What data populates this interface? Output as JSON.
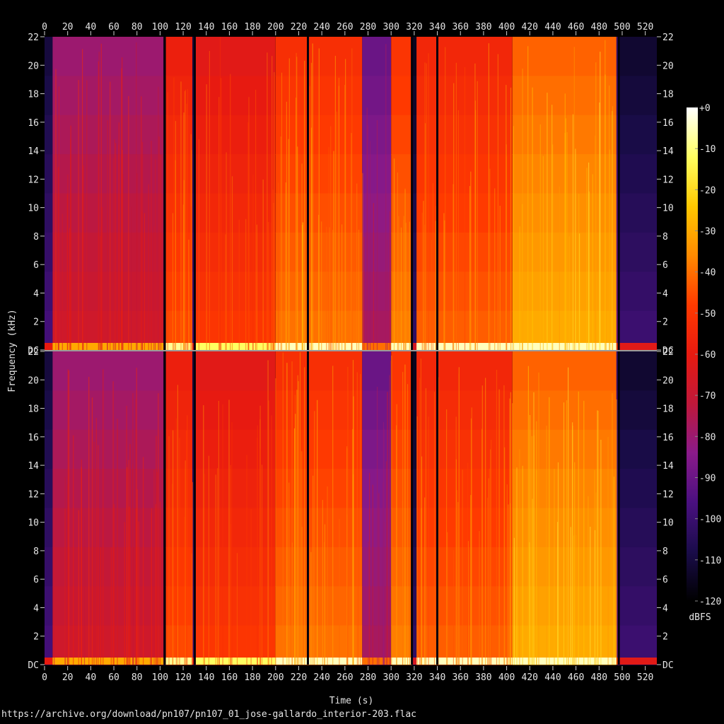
{
  "chart_data": {
    "type": "heatmap",
    "subtype": "spectrogram",
    "channels": 2,
    "xlabel": "Time (s)",
    "ylabel": "Frequency (kHz)",
    "x_ticks": [
      "0",
      "20",
      "40",
      "60",
      "80",
      "100",
      "120",
      "140",
      "160",
      "180",
      "200",
      "220",
      "240",
      "260",
      "280",
      "300",
      "320",
      "340",
      "360",
      "380",
      "400",
      "420",
      "440",
      "460",
      "480",
      "500",
      "520"
    ],
    "y_ticks": [
      "DC",
      "2",
      "4",
      "6",
      "8",
      "10",
      "12",
      "14",
      "16",
      "18",
      "20",
      "22"
    ],
    "xlim": [
      0,
      530
    ],
    "ylim_khz": [
      0,
      22
    ],
    "colorbar": {
      "label": "dBFS",
      "ticks": [
        "+0",
        "-10",
        "-20",
        "-30",
        "-40",
        "-50",
        "-60",
        "-70",
        "-80",
        "-90",
        "-100",
        "-110",
        "-120"
      ],
      "range_db": [
        -120,
        0
      ],
      "colors": [
        "#000000",
        "#1a0c4a",
        "#4a1080",
        "#8a1a8a",
        "#c0183a",
        "#e81a10",
        "#ff3a00",
        "#ff8a00",
        "#ffc800",
        "#ffff60",
        "#ffffff"
      ]
    },
    "segments": [
      {
        "start": 0,
        "end": 7,
        "level_db": -110
      },
      {
        "start": 7,
        "end": 103,
        "level_db": -80
      },
      {
        "start": 103,
        "end": 105,
        "level_db": -115
      },
      {
        "start": 105,
        "end": 128,
        "level_db": -58
      },
      {
        "start": 128,
        "end": 131,
        "level_db": -110
      },
      {
        "start": 131,
        "end": 200,
        "level_db": -62
      },
      {
        "start": 200,
        "end": 275,
        "level_db": -52
      },
      {
        "start": 275,
        "end": 300,
        "level_db": -90
      },
      {
        "start": 300,
        "end": 318,
        "level_db": -50
      },
      {
        "start": 318,
        "end": 322,
        "level_db": -115
      },
      {
        "start": 322,
        "end": 405,
        "level_db": -55
      },
      {
        "start": 405,
        "end": 495,
        "level_db": -42
      },
      {
        "start": 495,
        "end": 498,
        "level_db": -100
      },
      {
        "start": 498,
        "end": 530,
        "level_db": -112
      }
    ],
    "dark_gaps_s": [
      104,
      130,
      228,
      318,
      340,
      497
    ]
  },
  "footer": {
    "source_url": "https://archive.org/download/pn107/pn107_01_jose-gallardo_interior-203.flac"
  }
}
